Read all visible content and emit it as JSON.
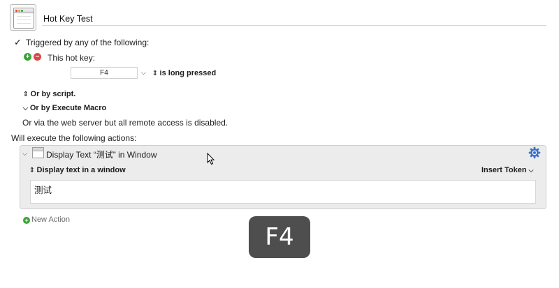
{
  "macro": {
    "name": "Hot Key Test"
  },
  "trigger": {
    "checked": true,
    "label": "Triggered by any of the following:",
    "hotkey_label": "This hot key:",
    "hotkey_value": "F4",
    "press_mode": "is long pressed",
    "or_script": "Or by script.",
    "or_execute_macro": "Or by Execute Macro",
    "web_note": "Or via the web server but all remote access is disabled."
  },
  "actions": {
    "heading": "Will execute the following actions:",
    "items": [
      {
        "title": "Display Text “测试” in Window",
        "display_mode": "Display text in a window",
        "insert_token": "Insert Token",
        "text": "测试"
      }
    ],
    "new_action": "New Action"
  },
  "overlay": {
    "text": "F4"
  },
  "icons": {
    "checkmark": "✓",
    "plus": "+",
    "minus": "−",
    "chevron_down": "⌄",
    "updown": "↕",
    "gear": "gear-icon"
  },
  "colors": {
    "add": "#3aa437",
    "remove": "#d94848",
    "overlay_bg": "#484848",
    "gear": "#3b74c7"
  }
}
